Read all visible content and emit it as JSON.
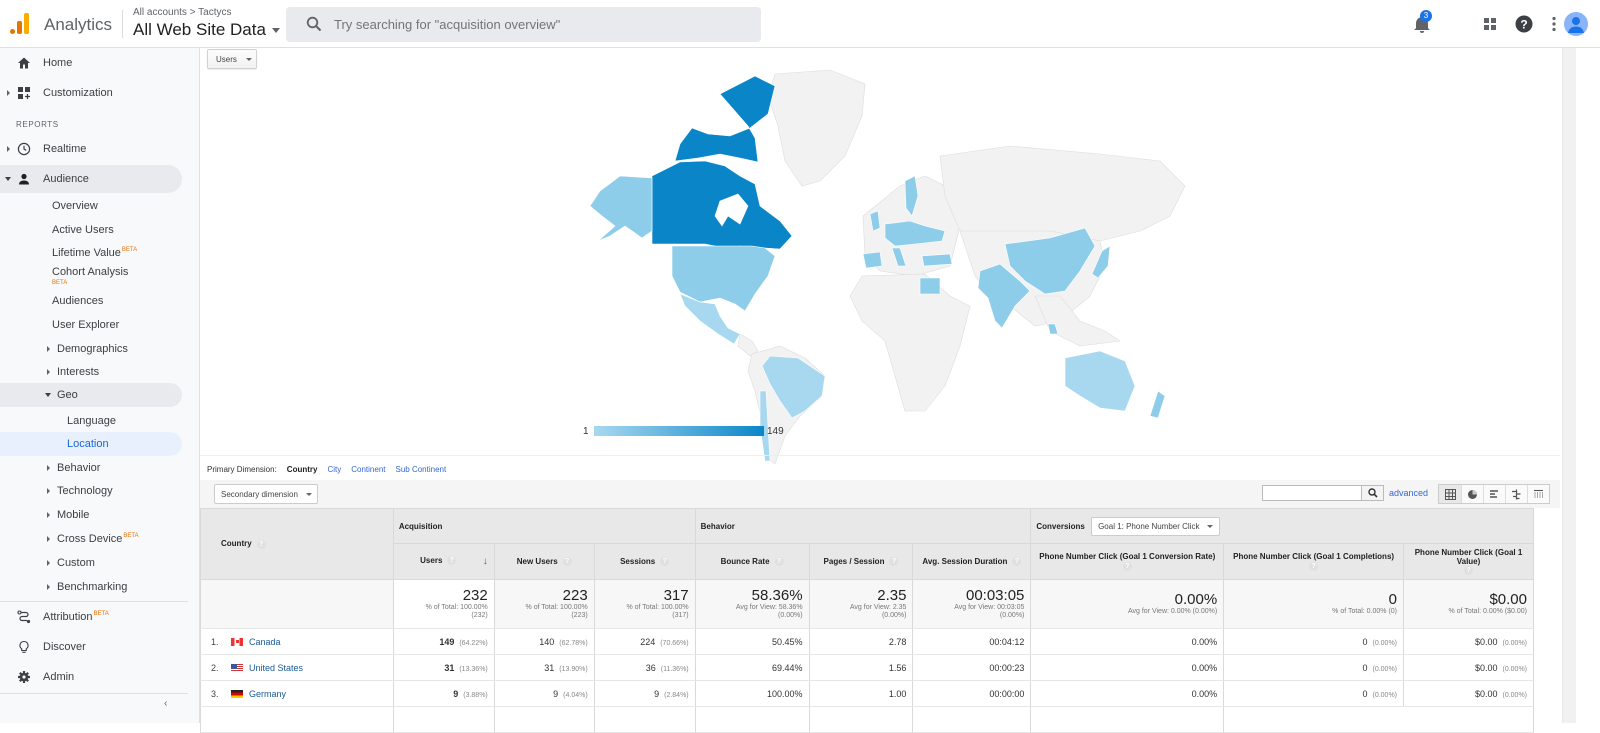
{
  "topbar": {
    "app_name": "Analytics",
    "breadcrumb": "All accounts > Tactycs",
    "property": "All Web Site Data",
    "search_placeholder": "Try searching for \"acquisition overview\"",
    "notification_count": "3"
  },
  "sidebar": {
    "home": "Home",
    "customization": "Customization",
    "reports_label": "REPORTS",
    "realtime": "Realtime",
    "audience": "Audience",
    "audience_items": {
      "overview": "Overview",
      "active_users": "Active Users",
      "lifetime_value": "Lifetime Value",
      "cohort_analysis": "Cohort Analysis",
      "audiences": "Audiences",
      "user_explorer": "User Explorer",
      "demographics": "Demographics",
      "interests": "Interests",
      "geo": "Geo",
      "language": "Language",
      "location": "Location",
      "behavior": "Behavior",
      "technology": "Technology",
      "mobile": "Mobile",
      "cross_device": "Cross Device",
      "custom": "Custom",
      "benchmarking": "Benchmarking"
    },
    "attribution": "Attribution",
    "discover": "Discover",
    "admin": "Admin",
    "beta_label": "BETA"
  },
  "map": {
    "metric_select": "Users",
    "legend_min": "1",
    "legend_max": "149",
    "colors": {
      "high": "#0a86c8",
      "low": "#a8d8f0",
      "none": "#f2f2f2"
    }
  },
  "dimensions": {
    "label": "Primary Dimension:",
    "current": "Country",
    "options": [
      "City",
      "Continent",
      "Sub Continent"
    ]
  },
  "toolbar": {
    "secondary_dimension": "Secondary dimension",
    "advanced": "advanced"
  },
  "table": {
    "country_header": "Country",
    "groups": {
      "acquisition": "Acquisition",
      "behavior": "Behavior",
      "conversions": "Conversions",
      "goal_select": "Goal 1: Phone Number Click"
    },
    "columns": [
      "Users",
      "New Users",
      "Sessions",
      "Bounce Rate",
      "Pages / Session",
      "Avg. Session Duration",
      "Phone Number Click (Goal 1 Conversion Rate)",
      "Phone Number Click (Goal 1 Completions)",
      "Phone Number Click (Goal 1 Value)"
    ],
    "totals": [
      {
        "value": "232",
        "sub1": "% of Total: 100.00%",
        "sub2": "(232)"
      },
      {
        "value": "223",
        "sub1": "% of Total: 100.00%",
        "sub2": "(223)"
      },
      {
        "value": "317",
        "sub1": "% of Total: 100.00%",
        "sub2": "(317)"
      },
      {
        "value": "58.36%",
        "sub1": "Avg for View: 58.36%",
        "sub2": "(0.00%)"
      },
      {
        "value": "2.35",
        "sub1": "Avg for View: 2.35",
        "sub2": "(0.00%)"
      },
      {
        "value": "00:03:05",
        "sub1": "Avg for View: 00:03:05",
        "sub2": "(0.00%)"
      },
      {
        "value": "0.00%",
        "sub1": "Avg for View: 0.00% (0.00%)",
        "sub2": ""
      },
      {
        "value": "0",
        "sub1": "% of Total: 0.00% (0)",
        "sub2": ""
      },
      {
        "value": "$0.00",
        "sub1": "% of Total: 0.00% ($0.00)",
        "sub2": ""
      }
    ],
    "rows": [
      {
        "rank": "1.",
        "flag": "ca",
        "country": "Canada",
        "users": "149",
        "users_pct": "(64.22%)",
        "new_users": "140",
        "new_users_pct": "(62.78%)",
        "sessions": "224",
        "sessions_pct": "(70.66%)",
        "bounce_rate": "50.45%",
        "pages_session": "2.78",
        "avg_duration": "00:04:12",
        "conv_rate": "0.00%",
        "completions": "0",
        "completions_pct": "(0.00%)",
        "value": "$0.00",
        "value_pct": "(0.00%)"
      },
      {
        "rank": "2.",
        "flag": "us",
        "country": "United States",
        "users": "31",
        "users_pct": "(13.36%)",
        "new_users": "31",
        "new_users_pct": "(13.90%)",
        "sessions": "36",
        "sessions_pct": "(11.36%)",
        "bounce_rate": "69.44%",
        "pages_session": "1.56",
        "avg_duration": "00:00:23",
        "conv_rate": "0.00%",
        "completions": "0",
        "completions_pct": "(0.00%)",
        "value": "$0.00",
        "value_pct": "(0.00%)"
      },
      {
        "rank": "3.",
        "flag": "de",
        "country": "Germany",
        "users": "9",
        "users_pct": "(3.88%)",
        "new_users": "9",
        "new_users_pct": "(4.04%)",
        "sessions": "9",
        "sessions_pct": "(2.84%)",
        "bounce_rate": "100.00%",
        "pages_session": "1.00",
        "avg_duration": "00:00:00",
        "conv_rate": "0.00%",
        "completions": "0",
        "completions_pct": "(0.00%)",
        "value": "$0.00",
        "value_pct": "(0.00%)"
      }
    ]
  }
}
